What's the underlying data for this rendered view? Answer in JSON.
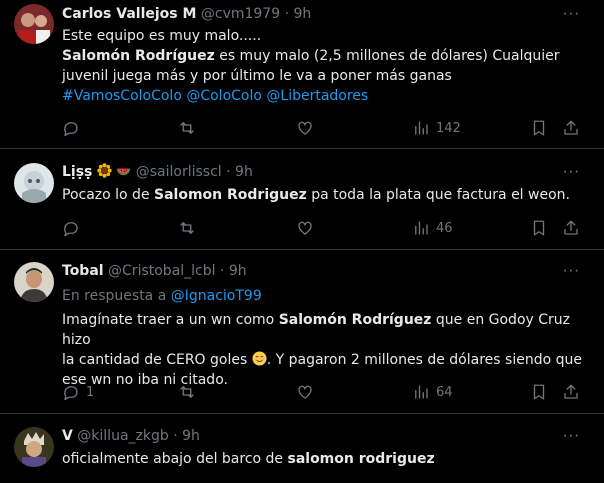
{
  "tweets": [
    {
      "name": "Carlos Vallejos M",
      "handle": "@cvm1979",
      "dot": "·",
      "time": "9h",
      "line1": "Este equipo es muy malo.....",
      "bold1": "Salomón Rodríguez",
      "line2_rest": " es muy malo (2,5 millones de dólares) Cualquier",
      "line3": "juvenil juega más y por último le va a poner más ganas",
      "hashtags": [
        "#VamosColoColo",
        "@ColoColo",
        "@Libertadores"
      ],
      "views": "142",
      "likes": ""
    },
    {
      "name": "Lịṣṣ",
      "handle": "@sailorlisscl",
      "dot": "·",
      "time": "9h",
      "text_pre": "Pocazo lo de ",
      "bold": "Salomon Rodriguez",
      "text_post": " pa toda la plata que factura el weon.",
      "views": "46"
    },
    {
      "name": "Tobal",
      "handle": "@Cristobal_lcbl",
      "dot": "·",
      "time": "9h",
      "reply_prefix": "En respuesta a ",
      "reply_to": "@IgnacioT99",
      "l1_pre": "Imagínate traer a un wn como ",
      "l1_bold": "Salomón Rodríguez",
      "l1_post": " que en Godoy Cruz hizo",
      "l2_pre": "la cantidad de CERO goles ",
      "l2_post": ". Y pagaron 2 millones de dólares siendo que",
      "l3": "ese wn no iba ni citado.",
      "replies": "1",
      "views": "64"
    },
    {
      "name": "V",
      "handle": "@killua_zkgb",
      "dot": "·",
      "time": "9h",
      "text_pre": "oficialmente abajo del barco de ",
      "bold": "salomon rodriguez"
    }
  ],
  "more_label": "···",
  "colors": {
    "bg": "#000000",
    "text": "#e7e9ea",
    "muted": "#71767b",
    "link": "#1d9bf0",
    "border": "#2f3336"
  }
}
